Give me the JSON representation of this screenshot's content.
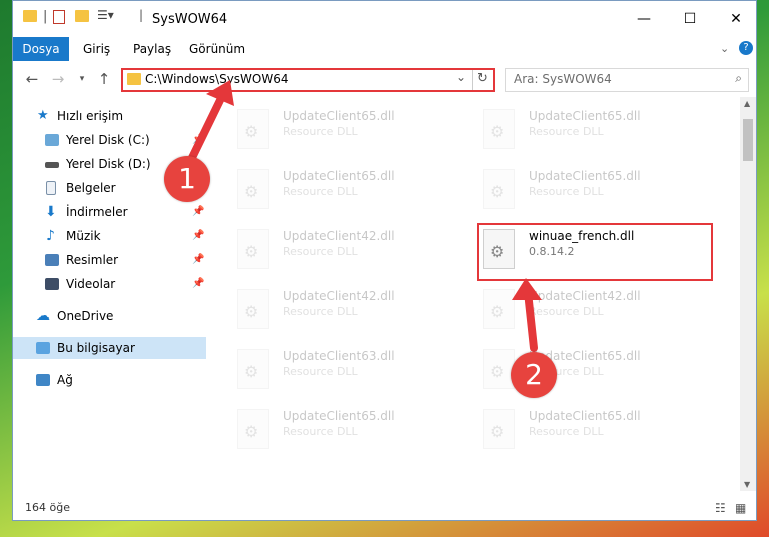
{
  "window": {
    "title": "SysWOW64"
  },
  "ribbon": {
    "tabs": [
      "Dosya",
      "Giriş",
      "Paylaş",
      "Görünüm"
    ]
  },
  "address": {
    "path": "C:\\Windows\\SysWOW64",
    "search_placeholder": "Ara: SysWOW64"
  },
  "nav": {
    "quick_access": "Hızlı erişim",
    "items": [
      {
        "label": "Yerel Disk (C:)",
        "pinned": true,
        "icon": "drive-icon"
      },
      {
        "label": "Yerel Disk (D:)",
        "pinned": false,
        "icon": "drive-icon"
      },
      {
        "label": "Belgeler",
        "pinned": true,
        "icon": "documents-icon"
      },
      {
        "label": "İndirmeler",
        "pinned": true,
        "icon": "downloads-icon"
      },
      {
        "label": "Müzik",
        "pinned": true,
        "icon": "music-icon"
      },
      {
        "label": "Resimler",
        "pinned": true,
        "icon": "pictures-icon"
      },
      {
        "label": "Videolar",
        "pinned": true,
        "icon": "videos-icon"
      }
    ],
    "onedrive": "OneDrive",
    "this_pc": "Bu bilgisayar",
    "network": "Ağ"
  },
  "files": [
    {
      "name": "UpdateClient65.dll",
      "sub": "Resource DLL"
    },
    {
      "name": "UpdateClient65.dll",
      "sub": "Resource DLL"
    },
    {
      "name": "UpdateClient65.dll",
      "sub": "Resource DLL"
    },
    {
      "name": "UpdateClient65.dll",
      "sub": "Resource DLL"
    },
    {
      "name": "UpdateClient42.dll",
      "sub": "Resource DLL"
    },
    {
      "name": "winuae_french.dll",
      "sub": "0.8.14.2"
    },
    {
      "name": "UpdateClient42.dll",
      "sub": "Resource DLL"
    },
    {
      "name": "UpdateClient42.dll",
      "sub": "Resource DLL"
    },
    {
      "name": "UpdateClient63.dll",
      "sub": "Resource DLL"
    },
    {
      "name": "UpdateClient65.dll",
      "sub": "Resource DLL"
    },
    {
      "name": "UpdateClient65.dll",
      "sub": "Resource DLL"
    },
    {
      "name": "UpdateClient65.dll",
      "sub": "Resource DLL"
    }
  ],
  "status": {
    "count": "164 öğe"
  },
  "markers": [
    "1",
    "2"
  ],
  "colors": {
    "accent": "#1979ca",
    "highlight": "#e4373a"
  }
}
